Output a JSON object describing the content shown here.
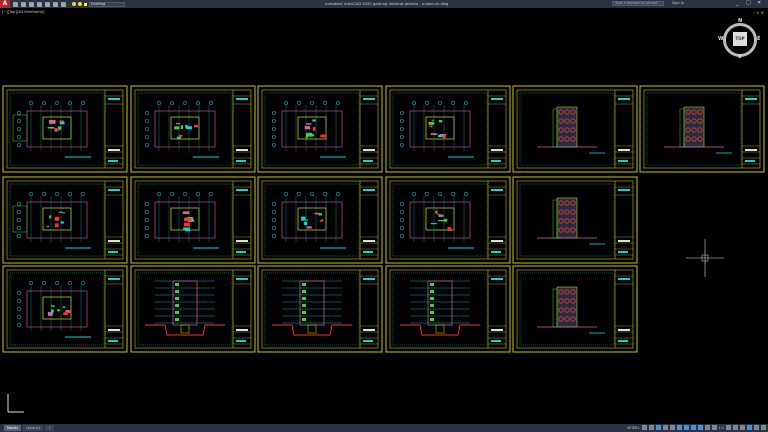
{
  "titlebar": {
    "app_title": "Autodesk AutoCAD 2020   gedung rektorat jakarta - audan.zk.dwg",
    "layer": "Drafting",
    "search_placeholder": "Type a keyword or phrase",
    "sign_in": "Sign In",
    "minimize": "_",
    "maximize": "□",
    "close": "✕"
  },
  "viewport": {
    "label": "[−][Top][2D Wireframe]",
    "controls": "– ▫ ✕"
  },
  "viewcube": {
    "top": "TOP",
    "n": "N",
    "e": "E",
    "s": "S",
    "w": "W"
  },
  "tabs": [
    "Model",
    "Layout1",
    "+"
  ],
  "status": {
    "mode": "MODEL",
    "scale": "1:1"
  },
  "colors": {
    "frame": "#c8c800",
    "cyan": "#00d8e8",
    "magenta": "#e060a0",
    "green": "#40d040",
    "red": "#ff3030",
    "background": "#000000"
  }
}
